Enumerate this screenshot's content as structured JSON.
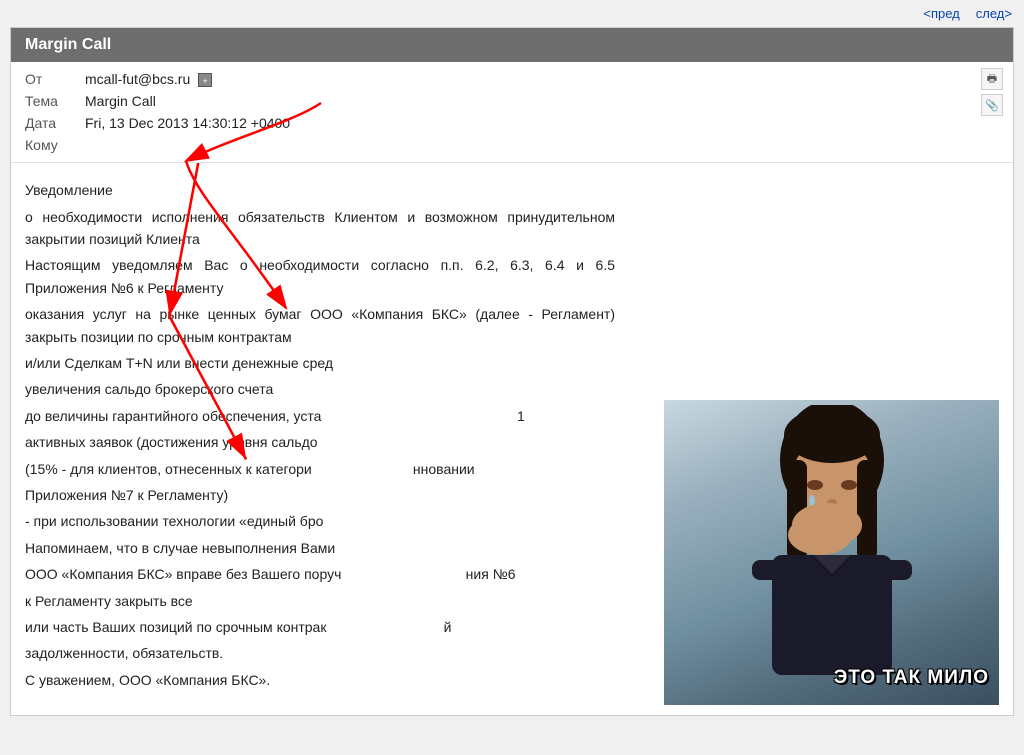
{
  "nav": {
    "prev_label": "<пред",
    "next_label": "след>"
  },
  "email": {
    "window_title": "Margin Call",
    "fields": {
      "from_label": "От",
      "from_value": "mcall-fut@bcs.ru",
      "subject_label": "Тема",
      "subject_value": "Margin Call",
      "date_label": "Дата",
      "date_value": "Fri, 13 Dec 2013 14:30:12 +0400",
      "to_label": "Кому",
      "to_value": ""
    },
    "body_lines": [
      "Уведомление",
      "о необходимости исполнения обязательств Клиентом и возможном принудительном закрытии позиций Клиента",
      "Настоящим уведомляем Вас о необходимости согласно п.п. 6.2, 6.3, 6.4 и 6.5 Приложения №6 к Регламенту",
      "оказания услуг на рынке ценных бумаг ООО «Компания БКС» (далее - Регламент) закрыть позиции по срочным контрактам",
      "и/или Сделкам T+N или внести денежные сред",
      "увеличения сальдо брокерского счета",
      "до величины гарантийного обеспечения, уста",
      "активных заявок (достижения уровня сальдо",
      "(15% - для клиентов, отнесенных к категори",
      "Приложения №7 к Регламенту)",
      "- при использовании технологии «единый бро",
      "Напоминаем, что в случае невыполнения Вами",
      "ООО «Компания БКС» вправе без Вашего поруч",
      "к Регламенту закрыть все",
      "или часть Ваших позиций по срочным контрак",
      "задолженности, обязательств.",
      "С уважением, ООО «Компания БКС»."
    ],
    "meme_text": "ЭТО ТАК МИЛО"
  }
}
